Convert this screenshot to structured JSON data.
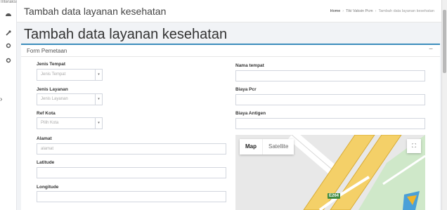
{
  "sidebar": {
    "top_text": "Interaksi",
    "icons": [
      "dashboard-icon",
      "wrench-icon",
      "circle-icon",
      "circle-icon"
    ]
  },
  "header": {
    "title": "Tambah data layanan kesehatan"
  },
  "breadcrumb": {
    "home": "Home",
    "section": "Tiki Vaksin Pcm",
    "current": "Tambah data layanan kesehatan"
  },
  "page": {
    "title": "Tambah data layanan kesehatan"
  },
  "form": {
    "title": "Form Pemetaan",
    "collapse_symbol": "−",
    "jenis_tempat": {
      "label": "Jenis Tempat",
      "placeholder": "Jenis Tempat"
    },
    "jenis_layanan": {
      "label": "Jenis Layanan",
      "placeholder": "Jenis Layanan"
    },
    "ref_kota": {
      "label": "Ref Kota",
      "placeholder": "Pilih Kota"
    },
    "alamat": {
      "label": "Alamat",
      "placeholder": "alamat"
    },
    "latitude": {
      "label": "Latitude",
      "value": ""
    },
    "longitude": {
      "label": "Longitude",
      "value": ""
    },
    "nama_tempat": {
      "label": "Nama tempat",
      "value": ""
    },
    "biaya_pcr": {
      "label": "Biaya Pcr",
      "value": ""
    },
    "biaya_antigen": {
      "label": "Biaya Antigen",
      "value": ""
    }
  },
  "map": {
    "map_label": "Map",
    "satellite_label": "Satellite",
    "road_label": "E264",
    "fullscreen_icon": "fullscreen-icon",
    "road_color": "#f4d068",
    "park_color": "#cfe8c9"
  },
  "colors": {
    "accent": "#3c8dbc"
  }
}
